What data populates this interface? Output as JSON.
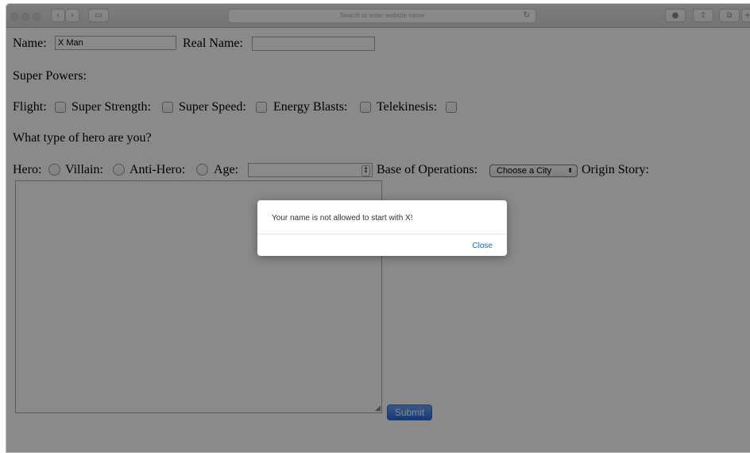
{
  "browser": {
    "address_placeholder": "Search or enter website name",
    "icons": [
      "back-chevron-icon",
      "forward-chevron-icon",
      "sidebar-icon",
      "reload-icon",
      "download-icon",
      "share-icon",
      "tabs-icon",
      "new-tab-icon"
    ]
  },
  "form": {
    "name_label": "Name:",
    "name_value": "X Man",
    "real_name_label": "Real Name:",
    "real_name_value": "",
    "super_powers_label": "Super Powers:",
    "powers": [
      "Flight:",
      "Super Strength:",
      "Super Speed:",
      "Energy Blasts:",
      "Telekinesis:"
    ],
    "hero_type_question": "What type of hero are you?",
    "hero_types": [
      "Hero:",
      "Villain:",
      "Anti-Hero:"
    ],
    "age_label": "Age:",
    "base_label": "Base of Operations:",
    "base_selected": "Choose a City",
    "origin_label": "Origin Story:",
    "submit_label": "Submit"
  },
  "dialog": {
    "message": "Your name is not allowed to start with X!",
    "close_label": "Close"
  },
  "colors": {
    "overlay": "#7a7a7a",
    "link_blue": "#1a66e0",
    "submit_blue": "#1f6ae6"
  }
}
